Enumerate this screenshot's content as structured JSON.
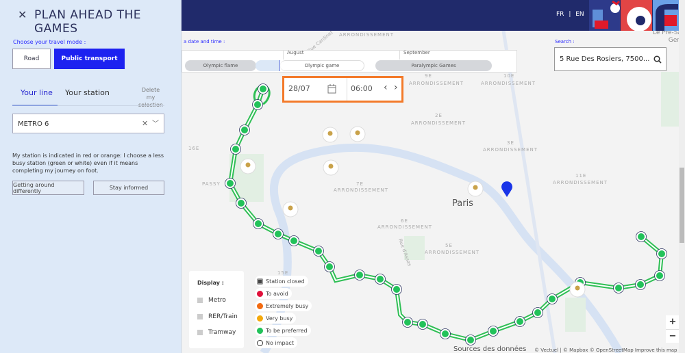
{
  "panel": {
    "title": "PLAN AHEAD THE GAMES",
    "mode_label": "Choose your travel mode :",
    "road": "Road",
    "public_transport": "Public transport",
    "tab_line": "Your line",
    "tab_station": "Your station",
    "delete": "Delete my selection",
    "line_value": "METRO 6",
    "info": "My station is indicated in red or orange: I choose a less busy station (green or white) even if it means completing my journey on foot.",
    "getting_around": "Getting around differently",
    "stay_informed": "Stay informed"
  },
  "header": {
    "lang_fr": "FR",
    "lang_sep": "|",
    "lang_en": "EN"
  },
  "timeline": {
    "label": "a date and time :",
    "months": [
      "August",
      "September"
    ],
    "periods": [
      "Olympic flame",
      "Olympic game",
      "Paralympic Games"
    ],
    "date": "28/07",
    "time": "06:00"
  },
  "search": {
    "label": "Search :",
    "value": "5 Rue Des Rosiers, 7500..."
  },
  "map": {
    "city": "Paris",
    "labels": [
      "ARRONDISSEMENT",
      "9E",
      "ARRONDISSEMENT",
      "10E",
      "ARRONDISSEMENT",
      "2E",
      "ARRONDISSEMENT",
      "3E",
      "ARRONDISSEMENT",
      "11E",
      "ARRONDISSEMENT",
      "16E",
      "PASSY",
      "7E",
      "ARRONDISSEMENT",
      "6E",
      "ARRONDISSEMENT",
      "5E",
      "ARRONDISSEMENT",
      "15E",
      "Le Pré-Saint-Gervais",
      "Rue d'Assas",
      "Rue Cardinet"
    ],
    "line_color": "#2fbf55"
  },
  "legend": {
    "display": "Display :",
    "toggles": [
      "Metro",
      "RER/Train",
      "Tramway"
    ],
    "statuses": [
      {
        "label": "Station closed",
        "color": "#444444"
      },
      {
        "label": "To avoid",
        "color": "#e0103a"
      },
      {
        "label": "Extremely busy",
        "color": "#f26a10"
      },
      {
        "label": "Very busy",
        "color": "#f4a90c"
      },
      {
        "label": "To be preferred",
        "color": "#22c25a"
      },
      {
        "label": "No impact",
        "color": "#ffffff"
      }
    ]
  },
  "attribution": {
    "sources": "Sources des données",
    "credits": "© Vectuel | © Mapbox © OpenStreetMap Improve this map"
  },
  "zoom": {
    "in": "+",
    "out": "−"
  }
}
